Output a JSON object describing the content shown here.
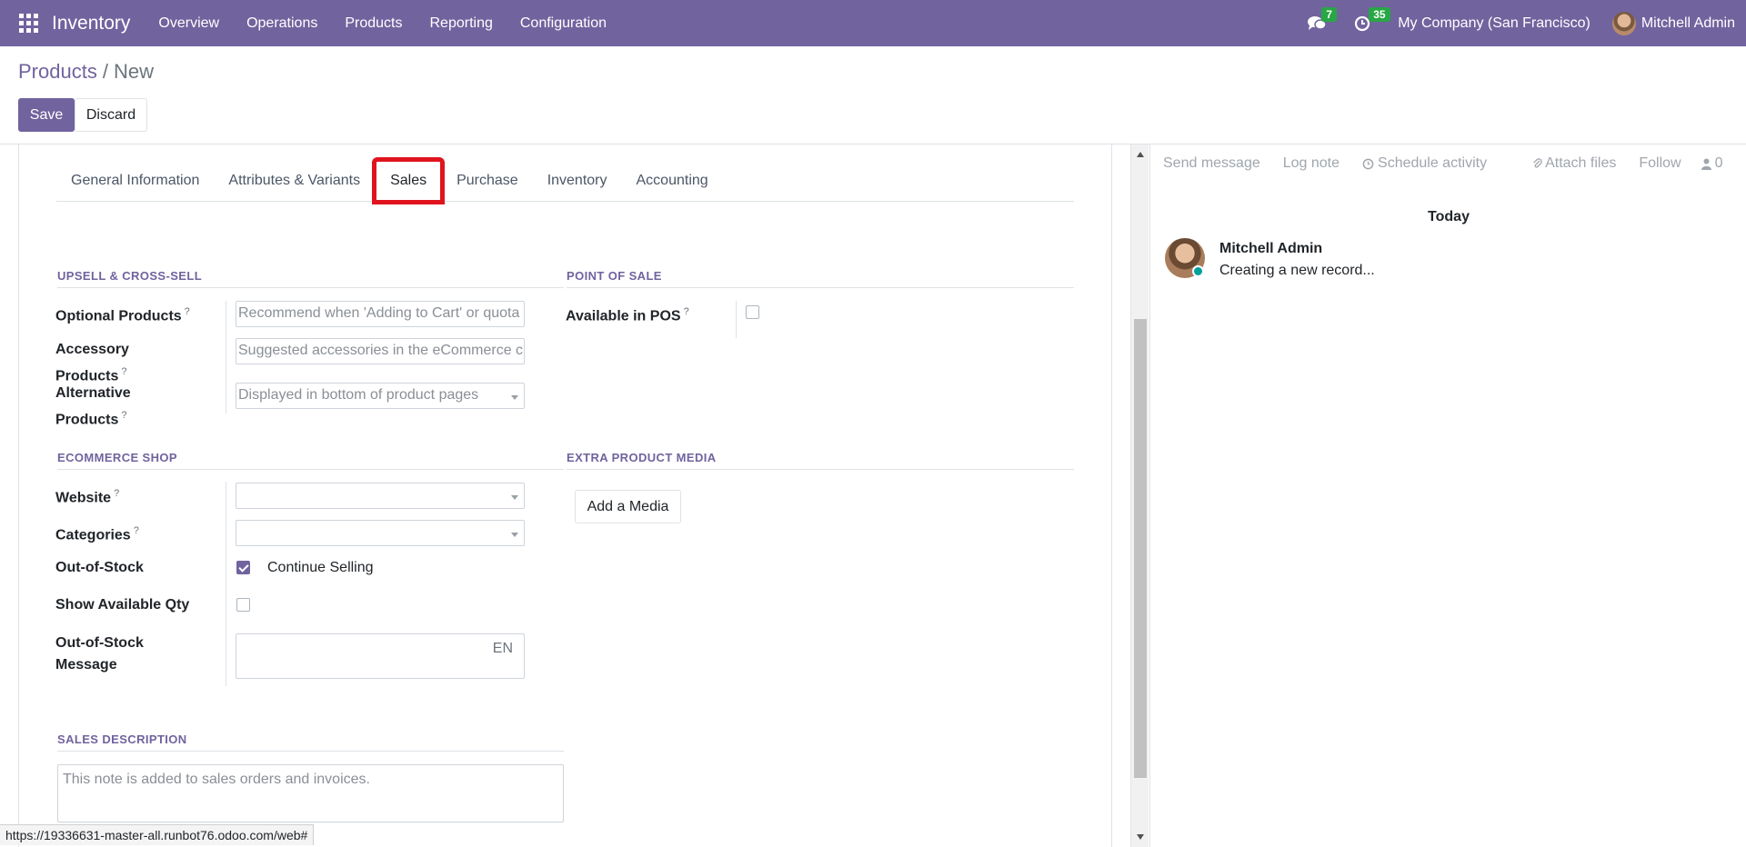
{
  "navbar": {
    "app_name": "Inventory",
    "menu": [
      "Overview",
      "Operations",
      "Products",
      "Reporting",
      "Configuration"
    ],
    "messages_count": "7",
    "activities_count": "35",
    "company": "My Company (San Francisco)",
    "user": "Mitchell Admin"
  },
  "breadcrumb": {
    "parent": "Products",
    "separator": "/",
    "current": "New"
  },
  "buttons": {
    "save": "Save",
    "discard": "Discard",
    "add_media": "Add a Media"
  },
  "tabs": [
    "General Information",
    "Attributes & Variants",
    "Sales",
    "Purchase",
    "Inventory",
    "Accounting"
  ],
  "active_tab": "Sales",
  "sections": {
    "upsell": "UPSELL & CROSS-SELL",
    "pos": "POINT OF SALE",
    "ecommerce": "ECOMMERCE SHOP",
    "media": "EXTRA PRODUCT MEDIA",
    "sales_desc": "SALES DESCRIPTION"
  },
  "fields": {
    "optional_products": {
      "label": "Optional Products",
      "help": "?",
      "placeholder": "Recommend when 'Adding to Cart' or quota"
    },
    "accessory_products": {
      "label_line1": "Accessory",
      "label_line2": "Products",
      "help": "?",
      "placeholder": "Suggested accessories in the eCommerce c"
    },
    "alternative_products": {
      "label_line1": "Alternative",
      "label_line2": "Products",
      "help": "?",
      "placeholder": "Displayed in bottom of product pages"
    },
    "available_in_pos": {
      "label": "Available in POS",
      "help": "?",
      "checked": false
    },
    "website": {
      "label": "Website",
      "help": "?",
      "value": ""
    },
    "categories": {
      "label": "Categories",
      "help": "?",
      "value": ""
    },
    "out_of_stock": {
      "label": "Out-of-Stock",
      "option": "Continue Selling",
      "checked": true
    },
    "show_available_qty": {
      "label": "Show Available Qty",
      "checked": false
    },
    "out_of_stock_message": {
      "label_line1": "Out-of-Stock",
      "label_line2": "Message",
      "lang": "EN"
    },
    "sales_description": {
      "placeholder": "This note is added to sales orders and invoices."
    }
  },
  "chatter": {
    "send_message": "Send message",
    "log_note": "Log note",
    "schedule_activity": "Schedule activity",
    "attach_files": "Attach files",
    "follow": "Follow",
    "followers_count": "0",
    "date_separator": "Today",
    "message_author": "Mitchell Admin",
    "message_body": "Creating a new record..."
  },
  "status_url": "https://19336631-master-all.runbot76.odoo.com/web#",
  "colors": {
    "brand": "#71639e",
    "badge": "#28a745",
    "highlight": "#e0141e",
    "online": "#00a09d"
  }
}
